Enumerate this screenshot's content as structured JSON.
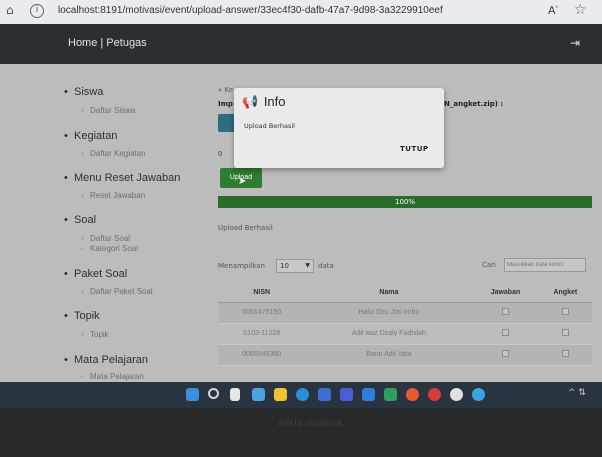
{
  "browser": {
    "url": "localhost:8191/motivasi/event/upload-answer/33ec4f30-dafb-47a7-9d98-3a3229910eef",
    "home_icon": "home-icon",
    "info_icon": "info-icon"
  },
  "app": {
    "brand": "Home | Petugas",
    "logout_icon": "logout-icon"
  },
  "sidebar": {
    "groups": [
      {
        "label": "Siswa",
        "items": [
          "Daftar Siswa"
        ]
      },
      {
        "label": "Kegiatan",
        "items": [
          "Daftar Kegiatan"
        ]
      },
      {
        "label": "Menu Reset Jawaban",
        "items": [
          "Reset Jawaban"
        ]
      },
      {
        "label": "Soal",
        "items": [
          "Daftar Soal",
          "Kategori Soal"
        ]
      },
      {
        "label": "Paket Soal",
        "items": [
          "Daftar Paket Soal"
        ]
      },
      {
        "label": "Topik",
        "items": [
          "Topik"
        ]
      },
      {
        "label": "Mata Pelajaran",
        "items": [
          "Mata Pelajaran"
        ]
      }
    ]
  },
  "main": {
    "breadcrumb": "« Ke",
    "import_label": "Imp",
    "import_hint": "N_angket.zip) :",
    "upload_button": "Upload",
    "progress": {
      "percent": 100,
      "label": "100%"
    },
    "status": "Upload Berhasil",
    "table_controls": {
      "show_label": "Menampilkan",
      "entries": "10",
      "data_label": "data",
      "search_label": "Cari",
      "search_placeholder": "Masukkan kata kunci"
    },
    "table": {
      "columns": [
        "NISN",
        "Nama",
        "Jawaban",
        "Angket"
      ],
      "rows": [
        {
          "nisn": "0061475150",
          "nama": "Hafiz Dzu Jori Imbu",
          "jawaban": "",
          "angket": ""
        },
        {
          "nisn": "0103-11228",
          "nama": "Adil waz Dzaly Fadhilah",
          "jawaban": "",
          "angket": ""
        },
        {
          "nisn": "0065049360",
          "nama": "Bann Adil Yata",
          "jawaban": "",
          "angket": ""
        }
      ]
    }
  },
  "modal": {
    "icon": "megaphone-icon",
    "title": "Info",
    "message": "Upload Berhasil",
    "close_label": "TUTUP"
  },
  "laptop": {
    "brand": "ASUS VivoBook"
  },
  "colors": {
    "upload_green": "#2f7d2f",
    "progress_green": "#2b6b2b",
    "header_dark": "#2b2f34",
    "file_button": "#2e6d80"
  }
}
